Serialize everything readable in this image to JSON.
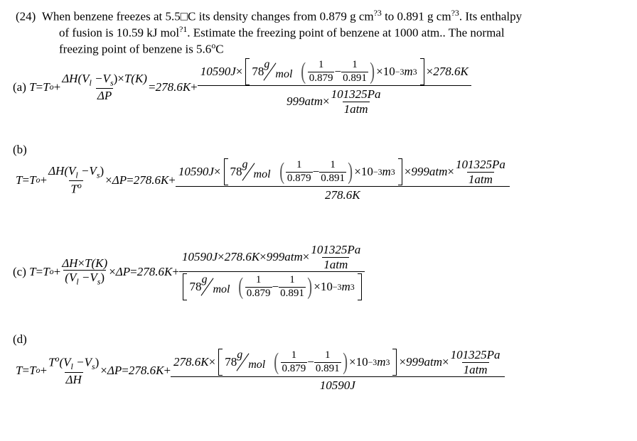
{
  "question": {
    "number": "(24)",
    "line1": "When benzene freezes at 5.5□C its density changes from 0.879 g cm",
    "line1_sup1": "?3",
    "line1_mid": " to 0.891 g cm",
    "line1_sup2": "?3",
    "line1_end": ". Its enthalpy",
    "line2": "of fusion is 10.59 kJ mol",
    "line2_sup": "?1",
    "line2_end": ". Estimate the freezing point of benzene at 1000 atm.. The normal",
    "line3": "freezing point of benzene is 5.6",
    "line3_sup": "o",
    "line3_end": "C"
  },
  "common": {
    "T": "T",
    "equals": " = ",
    "T0": "T",
    "T0_sup": "o",
    "plus": " + ",
    "times": "×",
    "minus": "−",
    "dH": "ΔH",
    "dP": "ΔP",
    "VlVs": "(V",
    "l": "l",
    "Vs": " −V",
    "s": "s",
    "close": ")",
    "TK": "T(K)",
    "T0val": "278.6K",
    "dHval": "10590J",
    "M": "78",
    "g": "g",
    "mol": "mol",
    "one": "1",
    "rho_l": "0.879",
    "rho_s": "0.891",
    "ten": "10",
    "exp": "−3",
    "m": "m",
    "m_exp": "3",
    "dPval": "999atm",
    "Pa": "101325Pa",
    "atm1": "1atm"
  },
  "options": {
    "a": {
      "label": "(a)"
    },
    "b": {
      "label": "(b)"
    },
    "c": {
      "label": "(c)"
    },
    "d": {
      "label": "(d)"
    }
  }
}
